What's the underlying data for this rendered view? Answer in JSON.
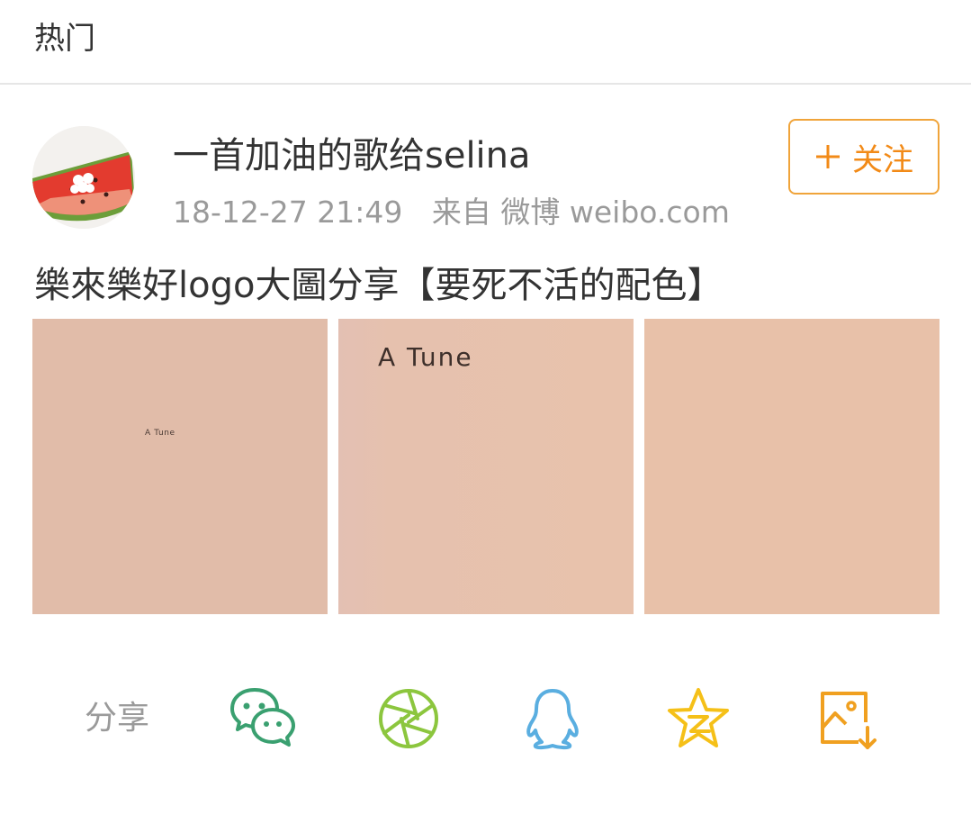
{
  "header": {
    "title": "热门"
  },
  "post": {
    "author": "一首加油的歌给selina",
    "timestamp": "18-12-27 21:49",
    "source": "来自 微博 weibo.com",
    "follow_label": "关注",
    "text": "樂來樂好logo大圖分享【要死不活的配色】",
    "images": [
      {
        "caption": "A Tune",
        "color": "#e1bca9"
      },
      {
        "caption": "A Tune",
        "color": "#e6c1ae"
      },
      {
        "caption": "",
        "color": "#e8c1a9"
      }
    ]
  },
  "share": {
    "label": "分享",
    "icons": [
      "wechat-icon",
      "moments-icon",
      "qq-icon",
      "qzone-icon",
      "save-image-icon"
    ]
  },
  "colors": {
    "accent": "#f28a17",
    "text": "#333333",
    "meta": "#9a9a9a",
    "wechat": "#3aa070",
    "moments": "#8cc63e",
    "qq": "#5aaee0",
    "qzone": "#f5c018",
    "save": "#f0a020"
  }
}
